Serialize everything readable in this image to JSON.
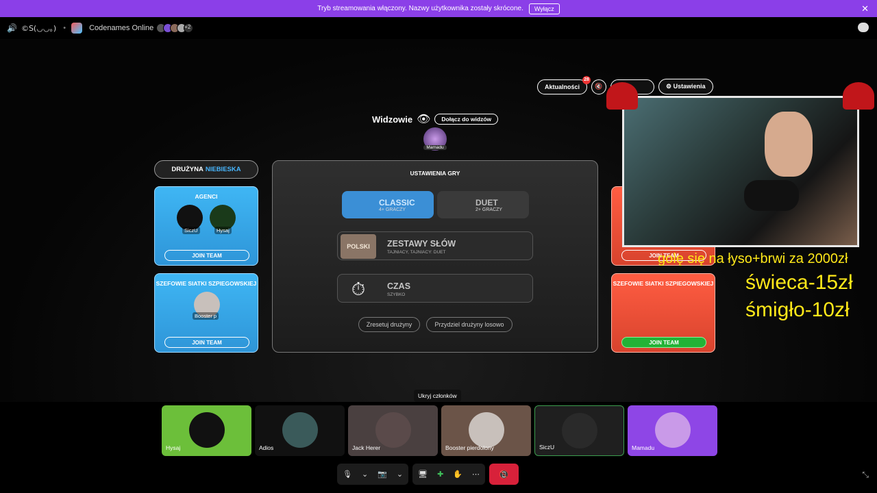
{
  "banner": {
    "text": "Tryb streamowania włączony. Nazwy użytkownika zostały skrócone.",
    "button": "Wyłącz"
  },
  "titlebar": {
    "channel": "©S(◡◡。)",
    "app": "Codenames Online",
    "extra_count": "+2"
  },
  "topbar": {
    "news": "Aktualności",
    "news_badge": "28",
    "settings": "Ustawienia"
  },
  "spectators": {
    "title": "Widzowie",
    "join": "Dołącz do widzów",
    "member": "Mamadu"
  },
  "blue_team": {
    "header_prefix": "DRUŻYNA",
    "header_color": "NIEBIESKA",
    "agents_title": "AGENCI",
    "agents": [
      "SiczU",
      "Hysaj"
    ],
    "join": "JOIN TEAM",
    "spymasters_title": "SZEFOWIE SIATKI SZPIEGOWSKIEJ",
    "spymasters": [
      "Booster p"
    ],
    "join2": "JOIN TEAM"
  },
  "red_team": {
    "join": "JOIN TEAM",
    "spymasters_title": "SZEFOWIE SIATKI SZPIEGOWSKIEJ",
    "join2": "JOIN TEAM"
  },
  "game_settings": {
    "title": "USTAWIENIA GRY",
    "modes": [
      {
        "name": "CLASSIC",
        "sub": "4+ GRACZY"
      },
      {
        "name": "DUET",
        "sub": "2+ GRACZY"
      }
    ],
    "wordsets": {
      "title": "ZESTAWY SŁÓW",
      "sub": "TAJNIACY, TAJNIACY: DUET",
      "badge": "POLSKI"
    },
    "time": {
      "title": "CZAS",
      "sub": "SZYBKO"
    },
    "reset": "Zresetuj drużyny",
    "random": "Przydziel drużyny losowo"
  },
  "overlay": {
    "line1": "golę się na łyso+brwi za 2000zł",
    "line2": "świeca-15zł",
    "line3": "śmigło-10zł"
  },
  "tooltip": "Ukryj członków",
  "members": [
    {
      "name": "Hysaj",
      "color": "#6cbf3a"
    },
    {
      "name": "Adios",
      "color": "#111111"
    },
    {
      "name": "Jack Herer",
      "color": "#4a4040"
    },
    {
      "name": "Booster pierdolony",
      "color": "#6b5448"
    },
    {
      "name": "SiczU",
      "color": "#1f1f1f"
    },
    {
      "name": "Mamadu",
      "color": "#8e46e6"
    }
  ]
}
